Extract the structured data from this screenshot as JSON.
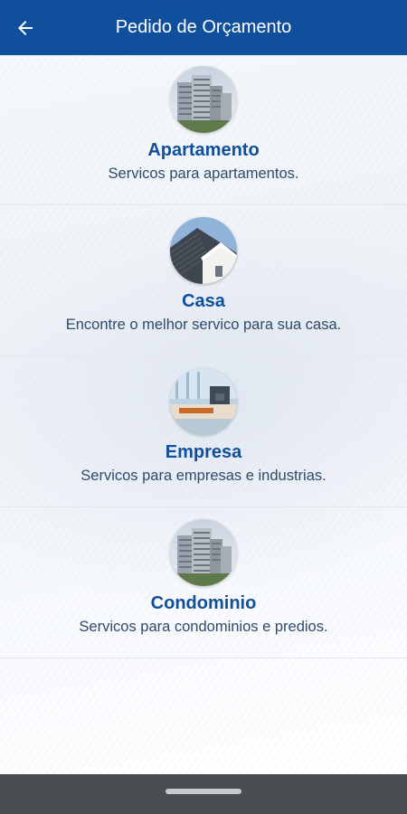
{
  "app_bar": {
    "title": "Pedido de Orçamento",
    "back_icon": "arrow-left-icon",
    "background": "#0f4f9c"
  },
  "options": [
    {
      "title": "Apartamento",
      "description": "Servicos para apartamentos.",
      "image": "apartment-buildings-image"
    },
    {
      "title": "Casa",
      "description": "Encontre o melhor servico para sua casa.",
      "image": "house-roof-image"
    },
    {
      "title": "Empresa",
      "description": "Servicos para empresas e industrias.",
      "image": "office-interior-image"
    },
    {
      "title": "Condominio",
      "description": "Servicos para condominios e predios.",
      "image": "condominium-buildings-image"
    }
  ],
  "colors": {
    "accent": "#0f4f9c",
    "description_text": "#2f4a6b",
    "nav_bar": "#4a4e52"
  }
}
